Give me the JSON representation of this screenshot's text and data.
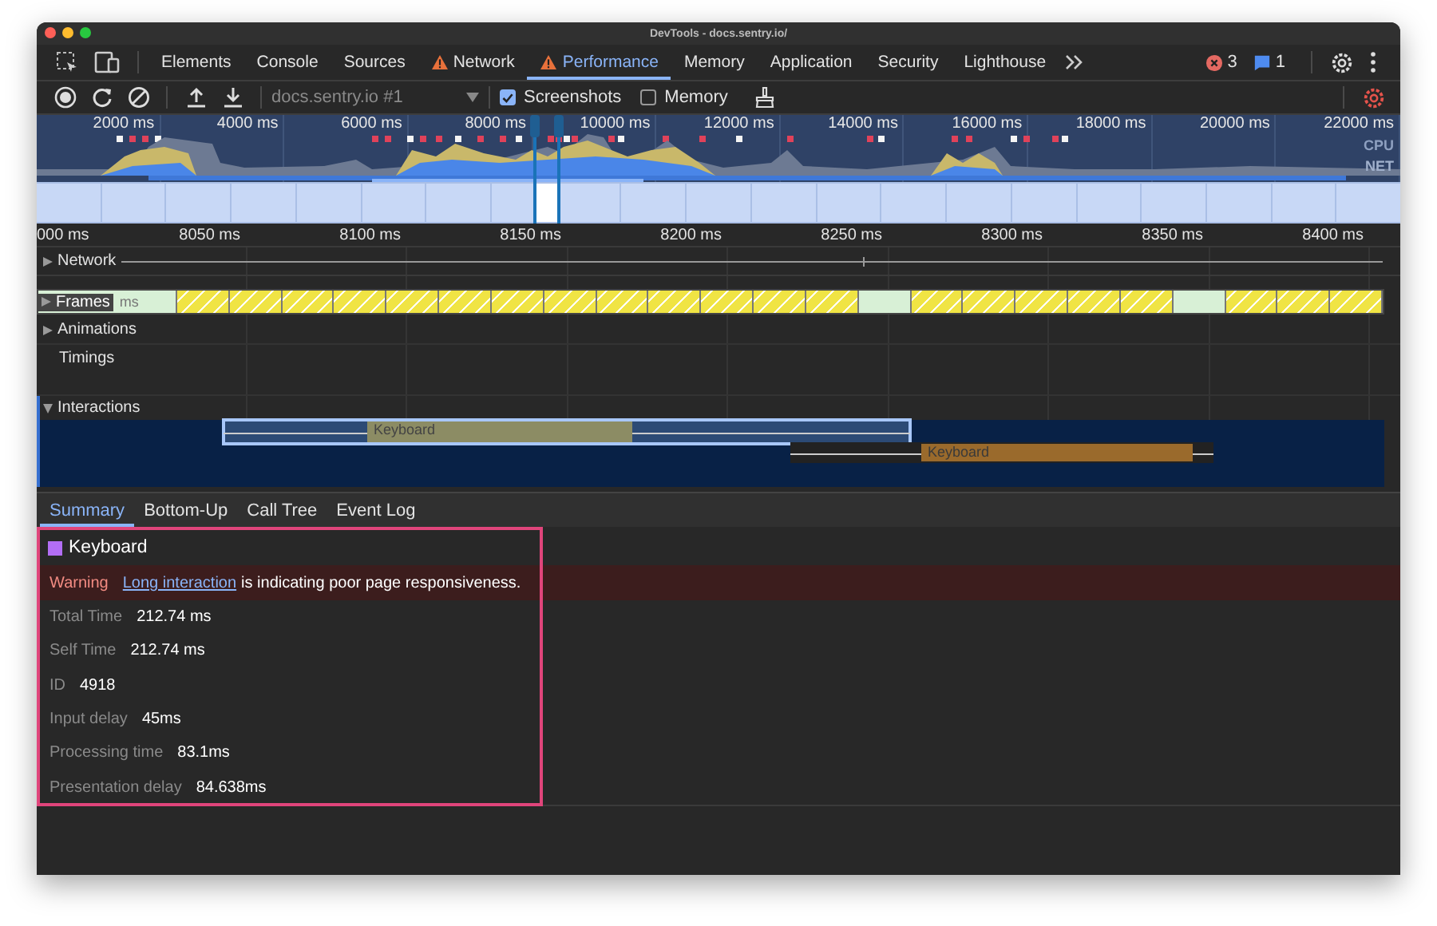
{
  "window": {
    "title": "DevTools - docs.sentry.io/"
  },
  "tabs": [
    {
      "label": "Elements",
      "selected": false,
      "warning": false
    },
    {
      "label": "Console",
      "selected": false,
      "warning": false
    },
    {
      "label": "Sources",
      "selected": false,
      "warning": false
    },
    {
      "label": "Network",
      "selected": false,
      "warning": true
    },
    {
      "label": "Performance",
      "selected": true,
      "warning": true
    },
    {
      "label": "Memory",
      "selected": false,
      "warning": false
    },
    {
      "label": "Application",
      "selected": false,
      "warning": false
    },
    {
      "label": "Security",
      "selected": false,
      "warning": false
    },
    {
      "label": "Lighthouse",
      "selected": false,
      "warning": false
    }
  ],
  "status": {
    "errors": "3",
    "messages": "1"
  },
  "toolbar": {
    "recording": "docs.sentry.io #1",
    "options": [
      {
        "label": "Screenshots",
        "checked": true
      },
      {
        "label": "Memory",
        "checked": false
      }
    ]
  },
  "overview": {
    "ticks": [
      "2000 ms",
      "4000 ms",
      "6000 ms",
      "8000 ms",
      "10000 ms",
      "12000 ms",
      "14000 ms",
      "16000 ms",
      "18000 ms",
      "20000 ms",
      "22000 ms"
    ],
    "cpu_label": "CPU",
    "net_label": "NET"
  },
  "ruler": {
    "ticks": [
      "000 ms",
      "8050 ms",
      "8100 ms",
      "8150 ms",
      "8200 ms",
      "8250 ms",
      "8300 ms",
      "8350 ms",
      "8400 ms"
    ]
  },
  "tracks": [
    {
      "kind": "network",
      "label": "Network",
      "expanded": false
    },
    {
      "kind": "frames",
      "label": "Frames",
      "expanded": false,
      "frames": [
        {
          "kind": "idle",
          "label": "ms"
        },
        {
          "kind": "partial"
        },
        {
          "kind": "partial"
        },
        {
          "kind": "partial"
        },
        {
          "kind": "partial"
        },
        {
          "kind": "partial"
        },
        {
          "kind": "partial"
        },
        {
          "kind": "partial"
        },
        {
          "kind": "partial"
        },
        {
          "kind": "partial"
        },
        {
          "kind": "partial"
        },
        {
          "kind": "partial"
        },
        {
          "kind": "partial"
        },
        {
          "kind": "partial"
        },
        {
          "kind": "idle"
        },
        {
          "kind": "partial"
        },
        {
          "kind": "partial"
        },
        {
          "kind": "partial"
        },
        {
          "kind": "partial"
        },
        {
          "kind": "partial"
        },
        {
          "kind": "idle"
        },
        {
          "kind": "partial"
        },
        {
          "kind": "partial"
        },
        {
          "kind": "partial"
        }
      ]
    },
    {
      "kind": "animations",
      "label": "Animations",
      "expanded": false
    },
    {
      "kind": "timings",
      "label": "Timings"
    },
    {
      "kind": "interactions",
      "label": "Interactions",
      "expanded": true,
      "events": [
        {
          "label": "Keyboard",
          "selected": true
        },
        {
          "label": "Keyboard",
          "selected": false
        }
      ]
    }
  ],
  "details_tabs": [
    {
      "label": "Summary",
      "selected": true
    },
    {
      "label": "Bottom-Up",
      "selected": false
    },
    {
      "label": "Call Tree",
      "selected": false
    },
    {
      "label": "Event Log",
      "selected": false
    }
  ],
  "summary": {
    "title": "Keyboard",
    "warning": {
      "label": "Warning",
      "link": "Long interaction",
      "message": "is indicating poor page responsiveness."
    },
    "fields": [
      {
        "label": "Total Time",
        "value": "212.74 ms"
      },
      {
        "label": "Self Time",
        "value": "212.74 ms"
      },
      {
        "label": "ID",
        "value": "4918"
      },
      {
        "label": "Input delay",
        "value": "45ms"
      },
      {
        "label": "Processing time",
        "value": "83.1ms"
      },
      {
        "label": "Presentation delay",
        "value": "84.638ms"
      }
    ]
  }
}
